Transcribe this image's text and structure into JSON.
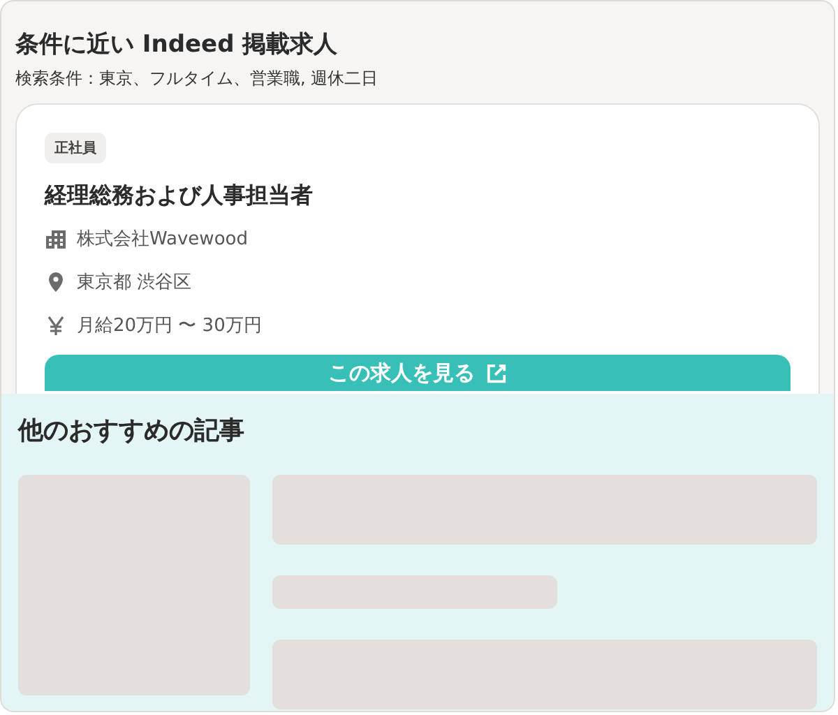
{
  "header": {
    "title": "条件に近い Indeed 掲載求人",
    "conditions": "検索条件：東京、フルタイム、営業職, 週休二日"
  },
  "job": {
    "tag": "正社員",
    "title": "経理総務および人事担当者",
    "details": [
      {
        "kind": "company",
        "text": "株式会社Wavewood"
      },
      {
        "kind": "location",
        "text": "東京都 渋谷区"
      },
      {
        "kind": "salary",
        "text": "月給20万円 〜 30万円"
      }
    ],
    "button": "この求人を見る"
  },
  "recommended": {
    "title": "他のおすすめの記事"
  }
}
